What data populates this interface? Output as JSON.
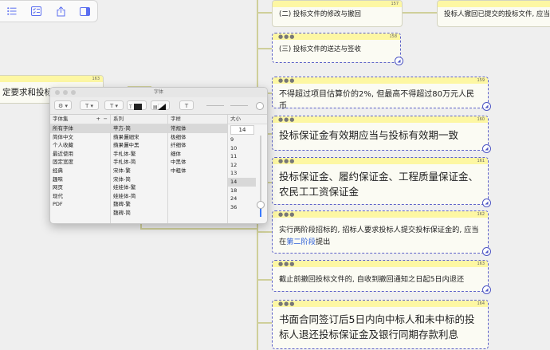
{
  "toolbar": {
    "icons": [
      "list-icon",
      "checklist-icon",
      "share-icon",
      "sidebar-icon"
    ]
  },
  "left_node": {
    "text": "定要求和投标",
    "num": "163"
  },
  "cards": [
    {
      "id": "c1",
      "text": "(二) 投标文件的修改与撤回",
      "num": "157"
    },
    {
      "id": "c2",
      "text": "投标人撤回已提交的投标文件, 应当在投标截",
      "num": ""
    },
    {
      "id": "c3",
      "text": "(三) 投标文件的送达与签收",
      "num": "158"
    },
    {
      "id": "c4",
      "text": "不得超过项目估算价的2%, 但最高不得超过80万元人民币",
      "num": "159"
    },
    {
      "id": "c5",
      "text": "投标保证金有效期应当与投标有效期一致",
      "num": "160"
    },
    {
      "id": "c6",
      "text": "投标保证金、履约保证金、工程质量保证金、农民工工资保证金",
      "num": "161"
    },
    {
      "id": "c7",
      "text_before": "实行两阶段招标的, 招标人要求投标人提交投标保证金的, 应当在",
      "link": "第二阶段",
      "text_after": "提出",
      "num": "162"
    },
    {
      "id": "c8",
      "text": "截止前撤回投标文件的, 自收到撤回通知之日起5日内退还",
      "num": "163"
    },
    {
      "id": "c9",
      "text": "书面合同签订后5日内向中标人和未中标的投标人退还投标保证金及银行同期存款利息",
      "num": "164"
    }
  ],
  "font_panel": {
    "title": "字体",
    "columns": {
      "collection_header": "字体集",
      "family_header": "系列",
      "typeface_header": "字样",
      "size_header": "大小"
    },
    "collections": [
      "所有字体",
      "简体中文",
      "个人收藏",
      "最近使用",
      "固定宽度",
      "经典",
      "趣味",
      "网页",
      "现代",
      "PDF"
    ],
    "families": [
      "苹方-简",
      "蘋果儷細宋",
      "蘋果儷中黑",
      "手札体-繁",
      "手札体-简",
      "宋体-繁",
      "宋体-简",
      "娃娃体-繁",
      "娃娃体-简",
      "魏碑-繁",
      "魏碑-简"
    ],
    "typefaces": [
      "常规体",
      "极细体",
      "纤细体",
      "细体",
      "中黑体",
      "中粗体"
    ],
    "size_value": "14",
    "sizes": [
      "9",
      "10",
      "11",
      "12",
      "13",
      "14",
      "18",
      "24",
      "36"
    ],
    "selected_collection": "所有字体",
    "selected_family": "苹方-简",
    "selected_typeface": "常规体",
    "selected_size": "14",
    "slider_fraction": 0.15
  },
  "colors": {
    "accent": "#5d62c8",
    "card_header": "#fdf7a3",
    "link": "#2d5ed8"
  }
}
